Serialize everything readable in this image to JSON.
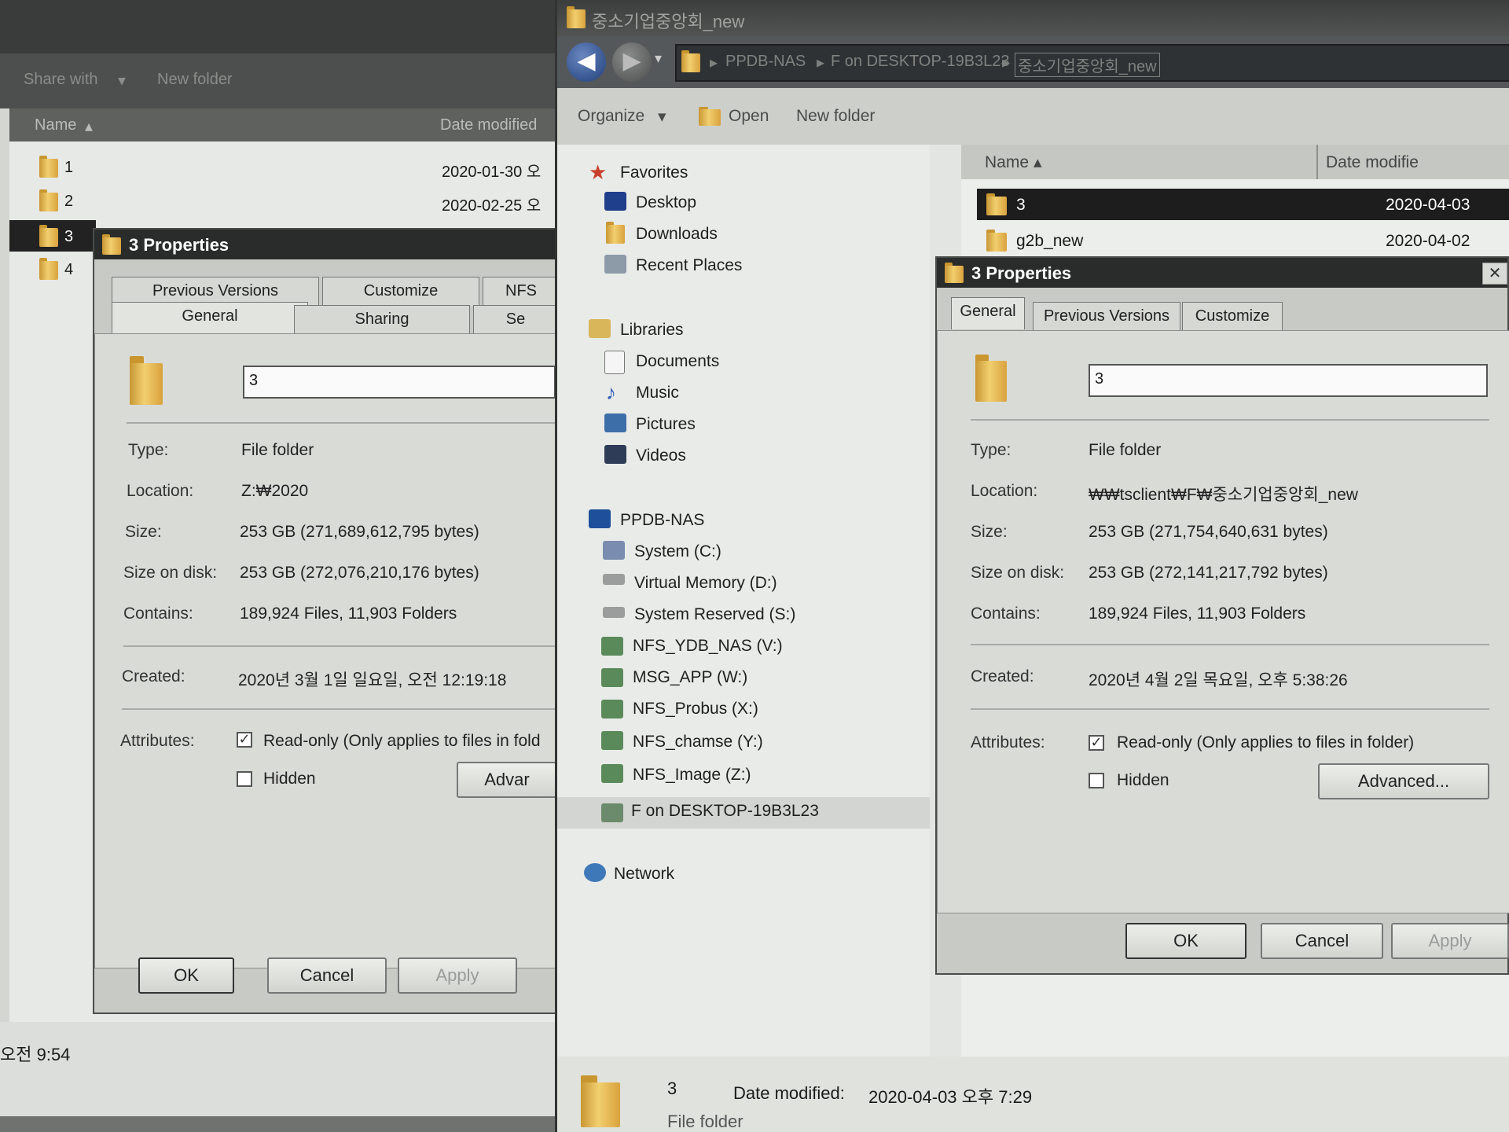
{
  "left_explorer": {
    "toolbar": {
      "share_with": "Share with",
      "new_folder": "New folder"
    },
    "columns": {
      "name": "Name",
      "date_modified": "Date modified"
    },
    "rows": [
      {
        "name": "1",
        "date": "2020-01-30 오"
      },
      {
        "name": "2",
        "date": "2020-02-25 오"
      },
      {
        "name": "3",
        "date": ""
      },
      {
        "name": "4",
        "date": ""
      }
    ],
    "status_time": "오전 9:54"
  },
  "left_dialog": {
    "title": "3 Properties",
    "tabs_back": [
      "Previous Versions",
      "Customize",
      "NFS"
    ],
    "tabs_front": [
      "General",
      "Sharing",
      "Se"
    ],
    "folder_name": "3",
    "fields": [
      {
        "label": "Type:",
        "value": "File folder"
      },
      {
        "label": "Location:",
        "value": "Z:₩2020"
      },
      {
        "label": "Size:",
        "value": "253 GB (271,689,612,795 bytes)"
      },
      {
        "label": "Size on disk:",
        "value": "253 GB (272,076,210,176 bytes)"
      },
      {
        "label": "Contains:",
        "value": "189,924 Files, 11,903 Folders"
      }
    ],
    "created_label": "Created:",
    "created_value": "2020년 3월 1일 일요일, 오전 12:19:18",
    "attributes_label": "Attributes:",
    "readonly_label": "Read-only (Only applies to files in fold",
    "hidden_label": "Hidden",
    "advanced_label": "Advar",
    "ok": "OK",
    "cancel": "Cancel",
    "apply": "Apply"
  },
  "mid_explorer": {
    "window_title": "중소기업중앙회_new",
    "breadcrumb": [
      "PPDB-NAS",
      "F on DESKTOP-19B3L23",
      "중소기업중앙회_new"
    ],
    "toolbar": {
      "organize": "Organize",
      "open": "Open",
      "new_folder": "New folder"
    },
    "nav": {
      "favorites": "Favorites",
      "favorites_items": [
        "Desktop",
        "Downloads",
        "Recent Places"
      ],
      "libraries": "Libraries",
      "libraries_items": [
        "Documents",
        "Music",
        "Pictures",
        "Videos"
      ],
      "computer": "PPDB-NAS",
      "drives": [
        "System  (C:)",
        "Virtual Memory (D:)",
        "System Reserved  (S:)",
        "NFS_YDB_NAS (V:)",
        "MSG_APP (W:)",
        "NFS_Probus (X:)",
        "NFS_chamse (Y:)",
        "NFS_Image (Z:)",
        "F on DESKTOP-19B3L23"
      ],
      "network": "Network"
    },
    "columns": {
      "name": "Name",
      "date_modified": "Date modifie"
    },
    "rows": [
      {
        "name": "3",
        "date": "2020-04-03"
      },
      {
        "name": "g2b_new",
        "date": "2020-04-02"
      }
    ],
    "details": {
      "name": "3",
      "date_label": "Date modified:",
      "date_value": "2020-04-03 오후 7:29",
      "type": "File folder"
    }
  },
  "right_dialog": {
    "title": "3 Properties",
    "tabs": [
      "General",
      "Previous Versions",
      "Customize"
    ],
    "folder_name": "3",
    "fields": [
      {
        "label": "Type:",
        "value": "File folder"
      },
      {
        "label": "Location:",
        "value": "₩₩tsclient₩F₩중소기업중앙회_new"
      },
      {
        "label": "Size:",
        "value": "253 GB (271,754,640,631 bytes)"
      },
      {
        "label": "Size on disk:",
        "value": "253 GB (272,141,217,792 bytes)"
      },
      {
        "label": "Contains:",
        "value": "189,924 Files, 11,903 Folders"
      }
    ],
    "created_label": "Created:",
    "created_value": "2020년 4월 2일 목요일, 오후 5:38:26",
    "attributes_label": "Attributes:",
    "readonly_label": "Read-only (Only applies to files in folder)",
    "hidden_label": "Hidden",
    "advanced_label": "Advanced...",
    "ok": "OK",
    "cancel": "Cancel",
    "apply": "Apply"
  }
}
